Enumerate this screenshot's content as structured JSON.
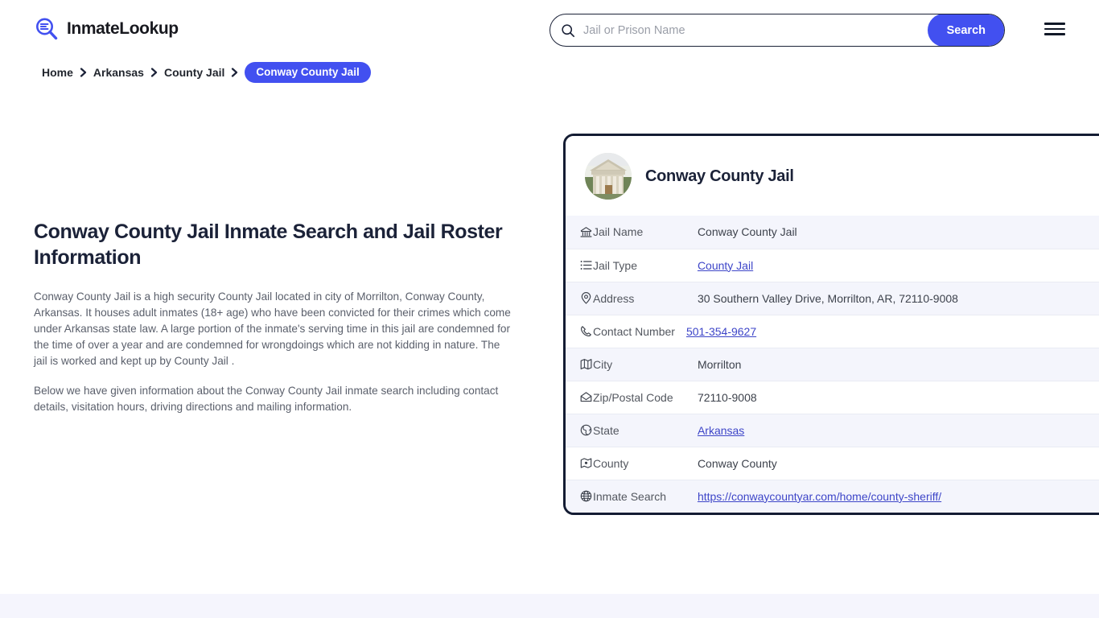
{
  "header": {
    "brand_name": "InmateLookup",
    "brand_icon": "magnifier-list-logo-icon",
    "search": {
      "placeholder": "Jail or Prison Name",
      "value": "",
      "button_label": "Search",
      "icon": "search-icon"
    },
    "menu_icon": "hamburger-menu-icon",
    "accent_color": "#4250f0"
  },
  "breadcrumb": {
    "items": [
      {
        "label": "Home",
        "current": false
      },
      {
        "label": "Arkansas",
        "current": false
      },
      {
        "label": "County Jail",
        "current": false
      },
      {
        "label": "Conway County Jail",
        "current": true
      }
    ],
    "separator_icon": "chevron-right-icon"
  },
  "main": {
    "page_title": "Conway County Jail Inmate Search and Jail Roster Information",
    "paragraph_1": "Conway County Jail is a high security County Jail located in city of Morrilton, Conway County, Arkansas. It houses adult inmates (18+ age) who have been convicted for their crimes which come under Arkansas state law. A large portion of the inmate's serving time in this jail are condemned for the time of over a year and are condemned for wrongdoings which are not kidding in nature. The jail is worked and kept up by County Jail .",
    "paragraph_2": "Below we have given information about the Conway County Jail inmate search including contact details, visitation hours, driving directions and mailing information."
  },
  "card": {
    "avatar_icon": "courthouse-photo",
    "title": "Conway County Jail",
    "rows": [
      {
        "icon": "bank-courthouse-icon",
        "label": "Jail Name",
        "value": "Conway County Jail",
        "link": false
      },
      {
        "icon": "list-icon",
        "label": "Jail Type",
        "value": "County Jail",
        "link": true
      },
      {
        "icon": "map-pin-icon",
        "label": "Address",
        "value": "30 Southern Valley Drive, Morrilton, AR, 72110-9008",
        "link": false
      },
      {
        "icon": "phone-icon",
        "label": "Contact Number",
        "value": "501-354-9627",
        "link": true
      },
      {
        "icon": "map-icon",
        "label": "City",
        "value": "Morrilton",
        "link": false
      },
      {
        "icon": "envelope-icon",
        "label": "Zip/Postal Code",
        "value": "72110-9008",
        "link": false
      },
      {
        "icon": "globe-americas-icon",
        "label": "State",
        "value": "Arkansas",
        "link": true
      },
      {
        "icon": "map-marked-icon",
        "label": "County",
        "value": "Conway County",
        "link": false
      },
      {
        "icon": "globe-network-icon",
        "label": "Inmate Search",
        "value": "https://conwaycountyar.com/home/county-sheriff/",
        "link": true
      }
    ]
  },
  "footer": {
    "band_color": "#f5f5fd"
  }
}
